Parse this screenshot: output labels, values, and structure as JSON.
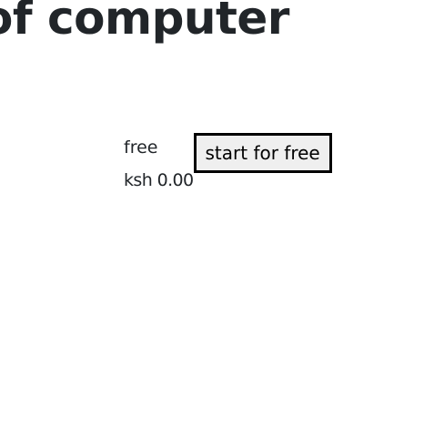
{
  "page": {
    "heading": "of computer"
  },
  "plan": {
    "name": "free",
    "price": "ksh 0.00",
    "cta_label": "start for free"
  }
}
